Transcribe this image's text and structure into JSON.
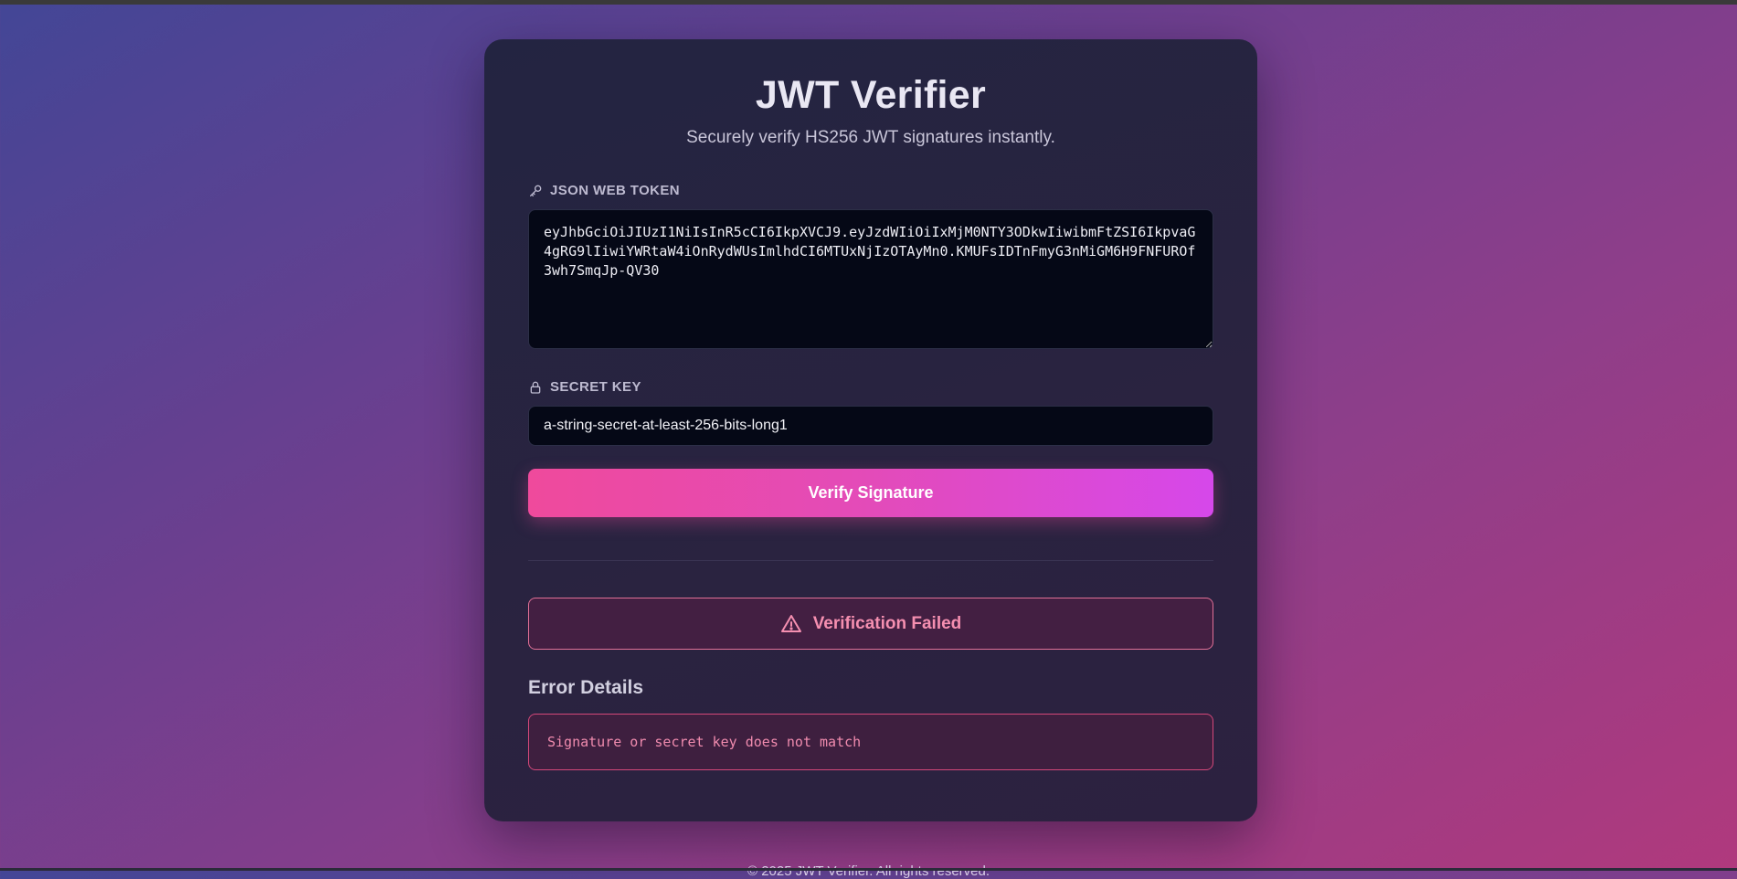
{
  "app": {
    "title": "JWT Verifier",
    "subtitle": "Securely verify HS256 JWT signatures instantly."
  },
  "token_field": {
    "label": "JSON WEB TOKEN",
    "icon": "key-icon",
    "value": "eyJhbGciOiJIUzI1NiIsInR5cCI6IkpXVCJ9.eyJzdWIiOiIxMjM0NTY3ODkwIiwibmFtZSI6IkpvaG4gRG9lIiwiYWRtaW4iOnRydWUsImlhdCI6MTUxNjIzOTAyMn0.KMUFsIDTnFmyG3nMiGM6H9FNFUROf3wh7SmqJp-QV30"
  },
  "secret_field": {
    "label": "SECRET KEY",
    "icon": "lock-icon",
    "value": "a-string-secret-at-least-256-bits-long1"
  },
  "verify_button": {
    "label": "Verify Signature"
  },
  "result": {
    "status": "Verification Failed",
    "icon": "warning-icon",
    "details_title": "Error Details",
    "details_message": "Signature or secret key does not match"
  },
  "footer": {
    "text": "© 2025 JWT Verifier. All rights reserved."
  },
  "colors": {
    "accent_start": "#ef4a9c",
    "accent_end": "#d648ea",
    "error": "#f58fb0"
  }
}
